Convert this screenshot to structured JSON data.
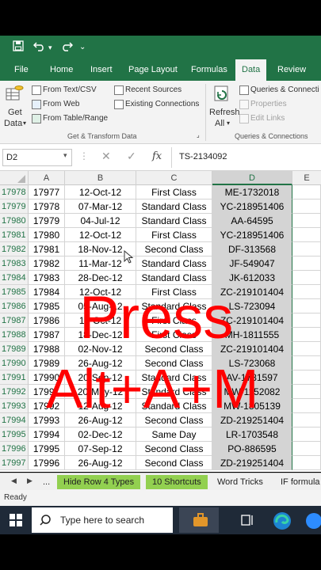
{
  "qat": {
    "save_icon": "save-icon",
    "undo_icon": "undo-icon",
    "redo_icon": "redo-icon"
  },
  "tabs": [
    "File",
    "Home",
    "Insert",
    "Page Layout",
    "Formulas",
    "Data",
    "Review"
  ],
  "active_tab": "Data",
  "ribbon": {
    "get_data": "Get",
    "get_data2": "Data",
    "from_text": "From Text/CSV",
    "from_web": "From Web",
    "from_table": "From Table/Range",
    "recent_sources": "Recent Sources",
    "existing_connections": "Existing Connections",
    "group_get_transform": "Get & Transform Data",
    "refresh": "Refresh",
    "refresh_all": "All",
    "queries_connections": "Queries & Connecti",
    "properties": "Properties",
    "edit_links": "Edit Links",
    "group_queries": "Queries & Connections"
  },
  "formula_bar": {
    "name_box": "D2",
    "fx": "fx",
    "value": "TS-2134092"
  },
  "columns": [
    "A",
    "B",
    "C",
    "D",
    "E"
  ],
  "rows": [
    {
      "num": "17978",
      "a": "17977",
      "b": "12-Oct-12",
      "c": "First Class",
      "d": "ME-1732018"
    },
    {
      "num": "17979",
      "a": "17978",
      "b": "07-Mar-12",
      "c": "Standard Class",
      "d": "YC-218951406"
    },
    {
      "num": "17980",
      "a": "17979",
      "b": "04-Jul-12",
      "c": "Standard Class",
      "d": "AA-64595"
    },
    {
      "num": "17981",
      "a": "17980",
      "b": "12-Oct-12",
      "c": "First Class",
      "d": "YC-218951406"
    },
    {
      "num": "17982",
      "a": "17981",
      "b": "18-Nov-12",
      "c": "Second Class",
      "d": "DF-313568"
    },
    {
      "num": "17983",
      "a": "17982",
      "b": "11-Mar-12",
      "c": "Standard Class",
      "d": "JF-549047"
    },
    {
      "num": "17984",
      "a": "17983",
      "b": "28-Dec-12",
      "c": "Standard Class",
      "d": "JK-612033"
    },
    {
      "num": "17985",
      "a": "17984",
      "b": "12-Oct-12",
      "c": "First Class",
      "d": "ZC-219101404"
    },
    {
      "num": "17986",
      "a": "17985",
      "b": "05-Aug-12",
      "c": "Standard Class",
      "d": "LS-723094"
    },
    {
      "num": "17987",
      "a": "17986",
      "b": "12-Oct-12",
      "c": "First Class",
      "d": "ZC-219101404"
    },
    {
      "num": "17988",
      "a": "17987",
      "b": "18-Dec-12",
      "c": "First Class",
      "d": "MH-1811555"
    },
    {
      "num": "17989",
      "a": "17988",
      "b": "02-Nov-12",
      "c": "Second Class",
      "d": "ZC-219101404"
    },
    {
      "num": "17990",
      "a": "17989",
      "b": "26-Aug-12",
      "c": "Second Class",
      "d": "LS-723068"
    },
    {
      "num": "17991",
      "a": "17990",
      "b": "20-Sep-12",
      "c": "Standard Class",
      "d": "AV-1781597"
    },
    {
      "num": "17992",
      "a": "17991",
      "b": "20-May-12",
      "c": "Standard Class",
      "d": "MW-1152082"
    },
    {
      "num": "17993",
      "a": "17992",
      "b": "12-Aug-12",
      "c": "Standard Class",
      "d": "MW-1805139"
    },
    {
      "num": "17994",
      "a": "17993",
      "b": "26-Aug-12",
      "c": "Second Class",
      "d": "ZD-219251404"
    },
    {
      "num": "17995",
      "a": "17994",
      "b": "02-Dec-12",
      "c": "Same Day",
      "d": "LR-1703548"
    },
    {
      "num": "17996",
      "a": "17995",
      "b": "07-Sep-12",
      "c": "Second Class",
      "d": "PO-886595"
    },
    {
      "num": "17997",
      "a": "17996",
      "b": "26-Aug-12",
      "c": "Second Class",
      "d": "ZD-219251404"
    }
  ],
  "sheet_tabs": [
    "...",
    "Hide Row 4 Types",
    "10 Shortcuts",
    "Word Tricks",
    "IF formula"
  ],
  "status": "Ready",
  "taskbar": {
    "search_placeholder": "Type here to search"
  },
  "overlay": {
    "line1": "Press",
    "line2": "Alt+A+M"
  },
  "colors": {
    "excel_green": "#217346",
    "tab_green": "#92d050",
    "overlay_red": "#ff0000",
    "selection_gray": "#d4d4d4"
  }
}
